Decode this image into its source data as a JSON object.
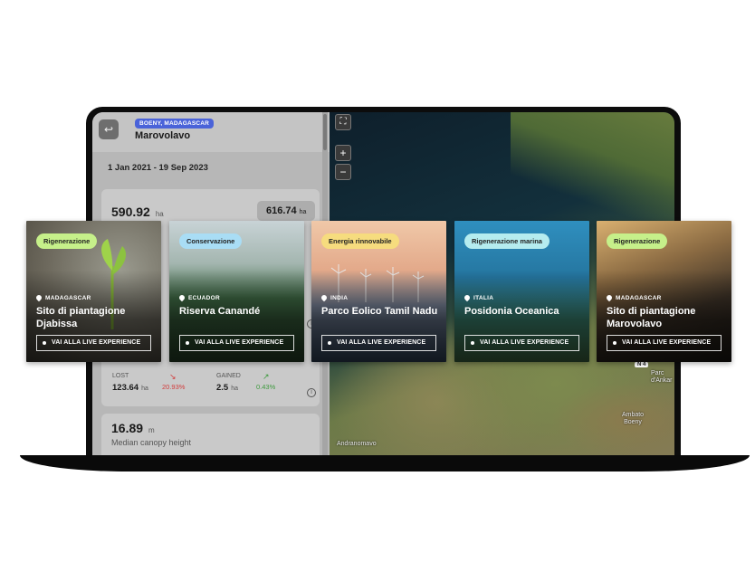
{
  "sidebar": {
    "location_badge": "BOENY, MADAGASCAR",
    "location_name": "Marovolavo",
    "date_range": "1 Jan 2021 - 19 Sep 2023",
    "total_value": "590.92",
    "total_unit": "ha",
    "secondary_value": "616.74",
    "secondary_unit": "ha",
    "lost_label": "LOST",
    "lost_value": "123.64",
    "lost_unit": "ha",
    "lost_pct": "20.93%",
    "gained_label": "GAINED",
    "gained_value": "2.5",
    "gained_unit": "ha",
    "gained_pct": "0.43%",
    "canopy_value": "16.89",
    "canopy_unit": "m",
    "canopy_label": "Median canopy height"
  },
  "map": {
    "zoom_in": "+",
    "zoom_out": "−",
    "labels": [
      "Andranomavo",
      "Ambato Boeny",
      "Parc d'Ankar"
    ],
    "road": "N 4"
  },
  "cards": [
    {
      "tag": "Rigenerazione",
      "tag_color": "#c6f08a",
      "country": "MADAGASCAR",
      "title": "Sito di piantagione Djabissa",
      "cta": "VAI ALLA LIVE EXPERIENCE"
    },
    {
      "tag": "Conservazione",
      "tag_color": "#a9ddf5",
      "country": "ECUADOR",
      "title": "Riserva Canandé",
      "cta": "VAI ALLA LIVE EXPERIENCE"
    },
    {
      "tag": "Energia rinnovabile",
      "tag_color": "#f6dc7e",
      "country": "INDIA",
      "title": "Parco Eolico Tamil Nadu",
      "cta": "VAI ALLA LIVE EXPERIENCE"
    },
    {
      "tag": "Rigenerazione marina",
      "tag_color": "#b5ecef",
      "country": "ITALIA",
      "title": "Posidonia Oceanica",
      "cta": "VAI ALLA LIVE EXPERIENCE"
    },
    {
      "tag": "Rigenerazione",
      "tag_color": "#c6f08a",
      "country": "MADAGASCAR",
      "title": "Sito di piantagione Marovolavo",
      "cta": "VAI ALLA LIVE EXPERIENCE"
    }
  ]
}
